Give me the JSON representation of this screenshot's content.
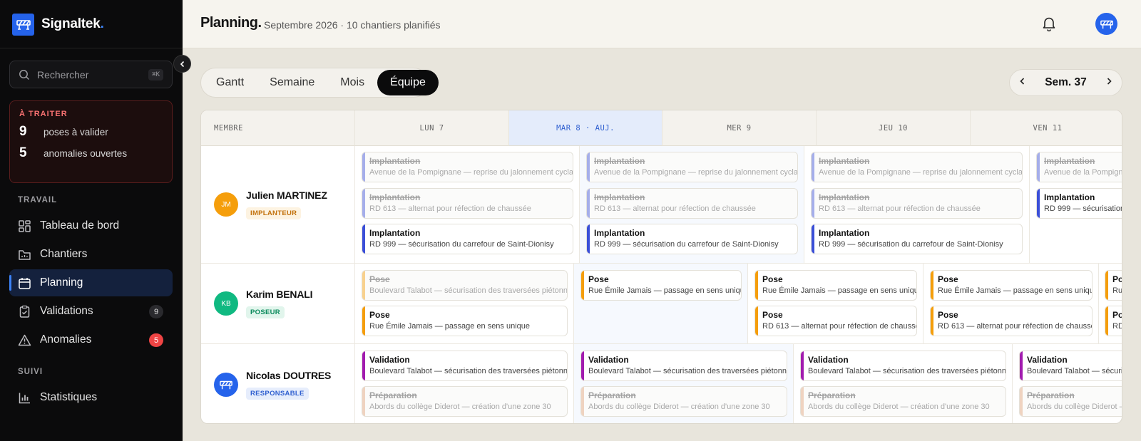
{
  "app": {
    "name": "Signaltek",
    "dot": "."
  },
  "search": {
    "placeholder": "Rechercher",
    "shortcut": "⌘K"
  },
  "todo": {
    "title": "À TRAITER",
    "items": [
      {
        "count": "9",
        "label": "poses à valider"
      },
      {
        "count": "5",
        "label": "anomalies ouvertes"
      }
    ]
  },
  "nav": {
    "sections": [
      "TRAVAIL",
      "SUIVI"
    ],
    "items": [
      {
        "label": "Tableau de bord",
        "icon": "grid-icon"
      },
      {
        "label": "Chantiers",
        "icon": "folder-icon"
      },
      {
        "label": "Planning",
        "icon": "calendar-icon",
        "active": true
      },
      {
        "label": "Validations",
        "icon": "clipboard-check-icon",
        "count": "9"
      },
      {
        "label": "Anomalies",
        "icon": "warning-icon",
        "count": "5"
      },
      {
        "label": "Statistiques",
        "icon": "bar-chart-icon"
      }
    ]
  },
  "header": {
    "title": "Planning.",
    "subtitle": "Septembre 2026 · 10 chantiers planifiés"
  },
  "view_tabs": [
    "Gantt",
    "Semaine",
    "Mois",
    "Équipe"
  ],
  "active_view": "Équipe",
  "week": {
    "label": "Sem. 37"
  },
  "grid": {
    "member_header": "MEMBRE",
    "days": [
      "LUN 7",
      "MAR 8 · AUJ.",
      "MER 9",
      "JEU 10",
      "VEN 11"
    ],
    "today_index": 1,
    "members": [
      {
        "initials": "JM",
        "name": "Julien MARTINEZ",
        "role": "IMPLANTEUR",
        "avatar_color": "#f59e0b",
        "role_bg": "#fdf3e1",
        "role_color": "#c2710c"
      },
      {
        "initials": "KB",
        "name": "Karim BENALI",
        "role": "POSEUR",
        "avatar_color": "#10b981",
        "role_bg": "#e1f5ec",
        "role_color": "#0b8a5c"
      },
      {
        "initials": "",
        "name": "Nicolas DOUTRES",
        "role": "RESPONSABLE",
        "avatar_color": "#2563eb",
        "role_bg": "#e6edfc",
        "role_color": "#2f5fd0"
      }
    ]
  },
  "tasks": {
    "implantation": "Implantation",
    "pose": "Pose",
    "validation": "Validation",
    "preparation": "Préparation",
    "pompignane": "Avenue de la Pompignane — reprise du jalonnement cyclable",
    "pompignane_cut": "Avenue de la Pompignan",
    "rd613": "RD 613 — alternat pour réfection de chaussée",
    "rd999": "RD 999 — sécurisation du carrefour de Saint-Dionisy",
    "rd999_cut": "RD 999 — sécurisation d",
    "talabot": "Boulevard Talabot — sécurisation des traversées piétonnes",
    "talabot_cut": "Boulevard Talabot — sécurisa",
    "jamais": "Rue Émile Jamais — passage en sens unique",
    "diderot": "Abords du collège Diderot — création d'une zone 30",
    "diderot_cut": "Abords du collège Diderot —",
    "pose_cut": "Po",
    "ru_cut": "Ru",
    "rd_cut": "RD"
  },
  "colors": {
    "implantation": "#3b4fd8",
    "pose": "#f59e0b",
    "validation": "#a21caf",
    "preparation": "#e0a27a",
    "accent": "#2563eb"
  }
}
